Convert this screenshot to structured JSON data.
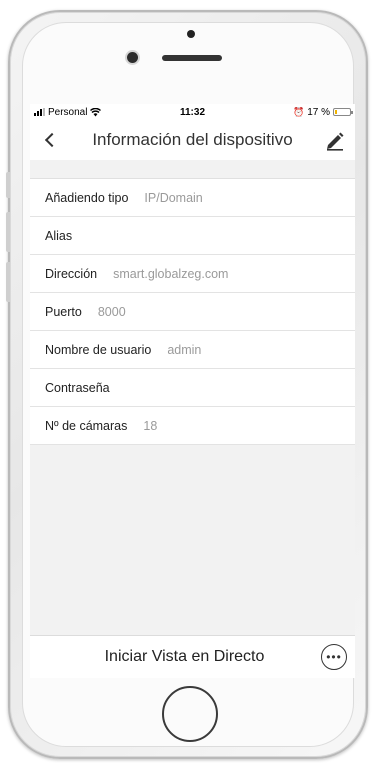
{
  "status_bar": {
    "carrier": "Personal",
    "time": "11:32",
    "battery_percent": "17 %",
    "battery_level": 0.17
  },
  "nav": {
    "title": "Información del dispositivo",
    "back_icon": "chevron-left-icon",
    "edit_icon": "pencil-icon"
  },
  "fields": [
    {
      "label": "Añadiendo tipo",
      "value": "IP/Domain"
    },
    {
      "label": "Alias",
      "value": ""
    },
    {
      "label": "Dirección",
      "value": "smart.globalzeg.com"
    },
    {
      "label": "Puerto",
      "value": "8000"
    },
    {
      "label": "Nombre de usuario",
      "value": "admin"
    },
    {
      "label": "Contraseña",
      "value": ""
    },
    {
      "label": "Nº de cámaras",
      "value": "18"
    }
  ],
  "bottom_bar": {
    "live_view_label": "Iniciar Vista en Directo",
    "more_icon": "more-options-icon"
  },
  "colors": {
    "battery_low": "#f0b400",
    "value_text": "#9a9a9a",
    "background": "#f2f2f2"
  }
}
